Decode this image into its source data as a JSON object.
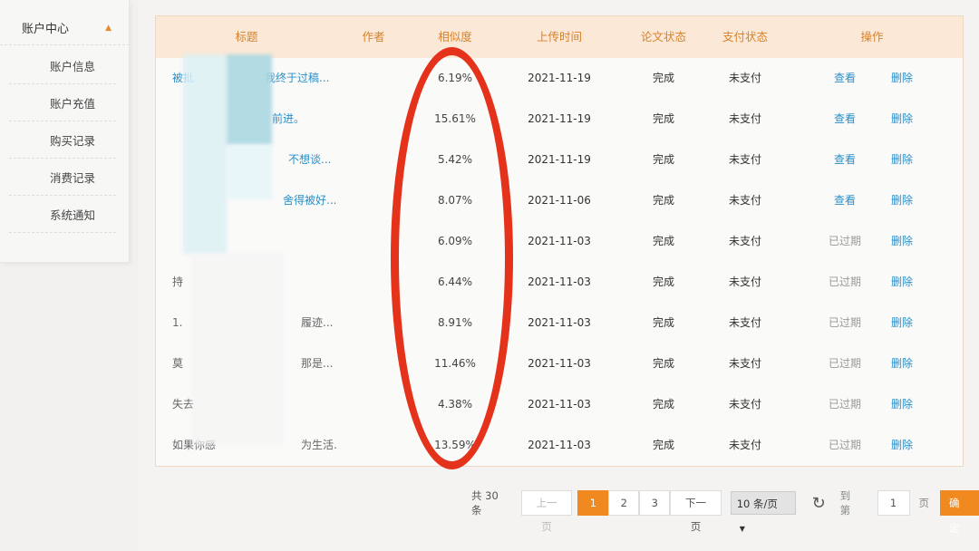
{
  "sidebar": {
    "header": "账户中心",
    "caret_icon": "caret-up-icon",
    "items": [
      "账户信息",
      "账户充值",
      "购买记录",
      "消费记录",
      "系统通知"
    ]
  },
  "table": {
    "headers": [
      "标题",
      "作者",
      "相似度",
      "上传时间",
      "论文状态",
      "支付状态",
      "操作"
    ],
    "rows": [
      {
        "title": "被批",
        "title_tail": "我终于过稿...",
        "similarity": "6.19%",
        "date": "2021-11-19",
        "paper_status": "完成",
        "pay_status": "未支付",
        "view": "查看",
        "delete": "删除"
      },
      {
        "title": "",
        "title_tail": "前进。",
        "similarity": "15.61%",
        "date": "2021-11-19",
        "paper_status": "完成",
        "pay_status": "未支付",
        "view": "查看",
        "delete": "删除"
      },
      {
        "title": "",
        "title_tail": "不想谈...",
        "similarity": "5.42%",
        "date": "2021-11-19",
        "paper_status": "完成",
        "pay_status": "未支付",
        "view": "查看",
        "delete": "删除"
      },
      {
        "title": "",
        "title_tail": "舍得被好...",
        "similarity": "8.07%",
        "date": "2021-11-06",
        "paper_status": "完成",
        "pay_status": "未支付",
        "view": "查看",
        "delete": "删除"
      },
      {
        "title": "",
        "title_tail": "",
        "similarity": "6.09%",
        "date": "2021-11-03",
        "paper_status": "完成",
        "pay_status": "未支付",
        "view": "已过期",
        "delete": "删除"
      },
      {
        "title": "持",
        "title_tail": "",
        "similarity": "6.44%",
        "date": "2021-11-03",
        "paper_status": "完成",
        "pay_status": "未支付",
        "view": "已过期",
        "delete": "删除"
      },
      {
        "title": "1.",
        "title_tail": "履迹...",
        "similarity": "8.91%",
        "date": "2021-11-03",
        "paper_status": "完成",
        "pay_status": "未支付",
        "view": "已过期",
        "delete": "删除"
      },
      {
        "title": "莫",
        "title_tail": "那是...",
        "similarity": "11.46%",
        "date": "2021-11-03",
        "paper_status": "完成",
        "pay_status": "未支付",
        "view": "已过期",
        "delete": "删除"
      },
      {
        "title": "失去",
        "title_tail": "",
        "similarity": "4.38%",
        "date": "2021-11-03",
        "paper_status": "完成",
        "pay_status": "未支付",
        "view": "已过期",
        "delete": "删除"
      },
      {
        "title": "如果你感",
        "title_tail": "为生活...",
        "similarity": "13.59%",
        "date": "2021-11-03",
        "paper_status": "完成",
        "pay_status": "未支付",
        "view": "已过期",
        "delete": "删除"
      }
    ]
  },
  "pagination": {
    "total": "共 30 条",
    "prev": "上一页",
    "pages": [
      "1",
      "2",
      "3"
    ],
    "next": "下一页",
    "page_size": "10 条/页",
    "goto_prefix": "到第",
    "goto_value": "1",
    "goto_suffix": "页",
    "confirm": "确定"
  },
  "colors": {
    "accent": "#f0891f",
    "header_bg": "#fbe8d6",
    "link": "#2a8fc9",
    "annotation": "#e4321b"
  }
}
